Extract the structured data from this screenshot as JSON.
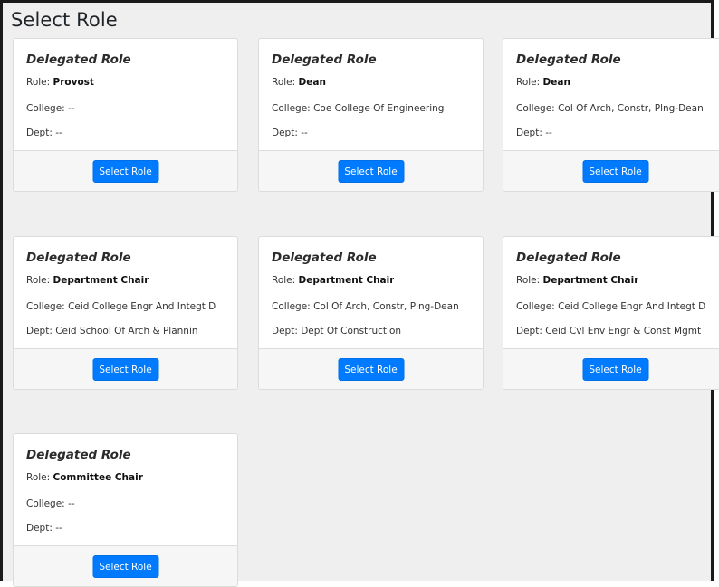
{
  "page": {
    "title": "Select Role"
  },
  "cards": [
    {
      "heading": "Delegated Role",
      "role_label": "Role: ",
      "role": "Provost",
      "college_label": "College: ",
      "college": "--",
      "dept_label": "Dept: ",
      "dept": "--",
      "button": "Select Role"
    },
    {
      "heading": "Delegated Role",
      "role_label": "Role: ",
      "role": "Dean",
      "college_label": "College: ",
      "college": "Coe College Of Engineering",
      "dept_label": "Dept: ",
      "dept": "--",
      "button": "Select Role"
    },
    {
      "heading": "Delegated Role",
      "role_label": "Role: ",
      "role": "Dean",
      "college_label": "College: ",
      "college": "Col Of Arch, Constr, Plng-Dean",
      "dept_label": "Dept: ",
      "dept": "--",
      "button": "Select Role"
    },
    {
      "heading": "Delegated Role",
      "role_label": "Role: ",
      "role": "Department Chair",
      "college_label": "College: ",
      "college": "Ceid College Engr And Integt D",
      "dept_label": "Dept: ",
      "dept": "Ceid School Of Arch & Plannin",
      "button": "Select Role"
    },
    {
      "heading": "Delegated Role",
      "role_label": "Role: ",
      "role": "Department Chair",
      "college_label": "College: ",
      "college": "Col Of Arch, Constr, Plng-Dean",
      "dept_label": "Dept: ",
      "dept": "Dept Of Construction",
      "button": "Select Role"
    },
    {
      "heading": "Delegated Role",
      "role_label": "Role: ",
      "role": "Department Chair",
      "college_label": "College: ",
      "college": "Ceid College Engr And Integt D",
      "dept_label": "Dept: ",
      "dept": "Ceid Cvl Env Engr & Const Mgmt",
      "button": "Select Role"
    },
    {
      "heading": "Delegated Role",
      "role_label": "Role: ",
      "role": "Committee Chair",
      "college_label": "College: ",
      "college": "--",
      "dept_label": "Dept: ",
      "dept": "--",
      "button": "Select Role"
    }
  ],
  "colors": {
    "primary_button": "#007bff",
    "page_background": "#efefef",
    "card_footer": "#f6f6f6"
  }
}
